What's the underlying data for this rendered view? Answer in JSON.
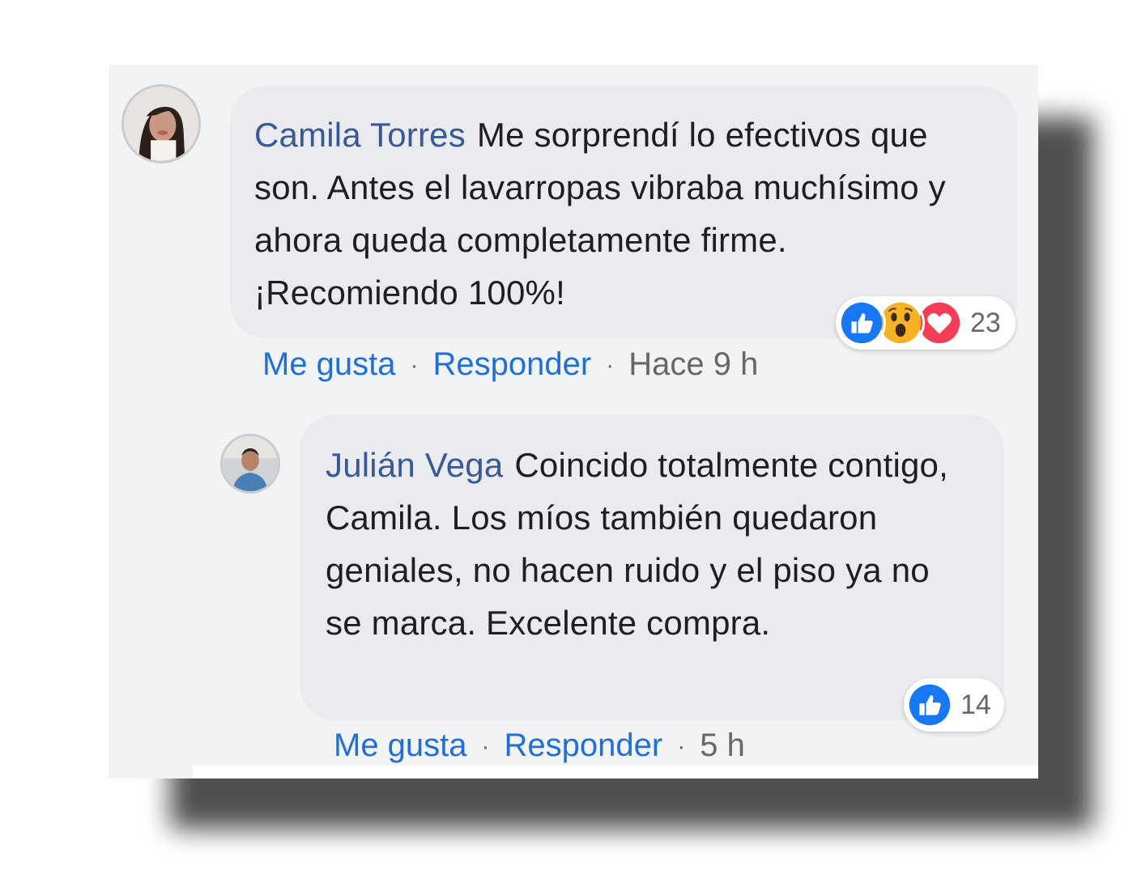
{
  "comments": [
    {
      "author": "Camila Torres",
      "text": "Me sorprendí lo efectivos que son. Antes el lavarropas vibraba muchísimo y ahora queda completamente firme. ¡Recomiendo 100%!",
      "like_label": "Me gusta",
      "reply_label": "Responder",
      "separator": "·",
      "time": "Hace 9 h",
      "reaction_icons": [
        "like-icon",
        "wow-icon",
        "love-icon"
      ],
      "reaction_count": "23"
    },
    {
      "author": "Julián Vega",
      "text": "Coincido totalmente contigo, Camila. Los míos también quedaron geniales, no hacen ruido y el piso ya no se marca. Excelente compra.",
      "like_label": "Me gusta",
      "reply_label": "Responder",
      "separator": "·",
      "time": "5 h",
      "reaction_icons": [
        "like-icon"
      ],
      "reaction_count": "14"
    }
  ],
  "colors": {
    "author": "#385898",
    "link": "#1f6fd6",
    "bubble": "#e9ebee",
    "panel": "#f2f3f5",
    "like": "#1877f2",
    "love": "#f33e58",
    "wow": "#f7b125"
  }
}
